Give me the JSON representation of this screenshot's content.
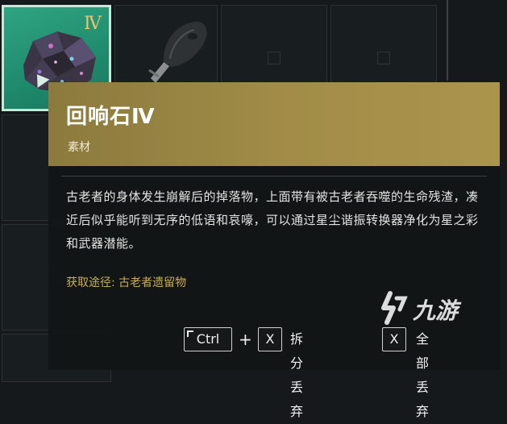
{
  "item": {
    "name": "回响石Ⅳ",
    "tier_badge": "Ⅳ",
    "category": "素材",
    "description": "古老者的身体发生崩解后的掉落物，上面带有被古老者吞噬的生命残渣，凑近后似乎能听到无序的低语和哀嚎，可以通过星尘谐振转换器净化为星之彩和武器潜能。",
    "source": "获取途径: 古老者遗留物"
  },
  "actions": {
    "ctrl_key": "Ctrl",
    "plus": "+",
    "x_key": "X",
    "split_discard_label": "拆分丢弃",
    "x_key_2": "X",
    "discard_all_label": "全部丢弃"
  },
  "watermark": {
    "text": "九游"
  },
  "colors": {
    "selected_slot": "#2fa483",
    "header_gold": "#a28d48",
    "source_text": "#c9ad56"
  }
}
